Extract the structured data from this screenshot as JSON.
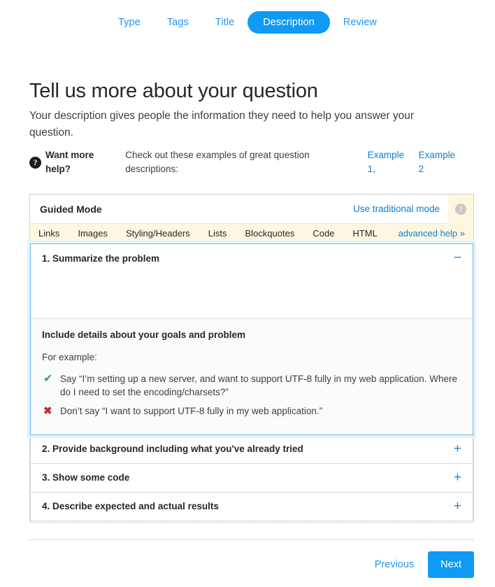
{
  "wizard": {
    "tabs": [
      {
        "label": "Type",
        "active": false
      },
      {
        "label": "Tags",
        "active": false
      },
      {
        "label": "Title",
        "active": false
      },
      {
        "label": "Description",
        "active": true
      },
      {
        "label": "Review",
        "active": false
      }
    ]
  },
  "heading": {
    "title": "Tell us more about your question",
    "subtitle": "Your description gives people the information they need to help you answer your question."
  },
  "help_line": {
    "icon": "question-mark-circle-icon",
    "strong": "Want more help?",
    "text": "Check out these examples of great question descriptions:",
    "link1": "Example 1,",
    "link2": "Example 2"
  },
  "editor": {
    "guided_mode_label": "Guided Mode",
    "traditional_mode_link": "Use traditional mode",
    "help_tab_icon": "question-mark-circle-icon",
    "help_glyph": "?",
    "format_items": [
      "Links",
      "Images",
      "Styling/Headers",
      "Lists",
      "Blockquotes",
      "Code",
      "HTML"
    ],
    "advanced_help": "advanced help »"
  },
  "sections": [
    {
      "title": "1. Summarize the problem",
      "toggle": "−",
      "expanded": true,
      "editor_value": "",
      "editor_placeholder": "",
      "detail": {
        "title": "Include details about your goals and problem",
        "for_example": "For example:",
        "examples": [
          {
            "icon": "check-icon",
            "glyph": "✔",
            "kind": "good",
            "text": "Say “I’m setting up a new server, and want to support UTF-8 fully in my web application. Where do I need to set the encoding/charsets?”"
          },
          {
            "icon": "cross-icon",
            "glyph": "✖",
            "kind": "bad",
            "text": "Don’t say “I want to support UTF-8 fully in my web application.”"
          }
        ]
      }
    },
    {
      "title": "2. Provide background including what you've already tried",
      "toggle": "+",
      "expanded": false
    },
    {
      "title": "3. Show some code",
      "toggle": "+",
      "expanded": false
    },
    {
      "title": "4. Describe expected and actual results",
      "toggle": "+",
      "expanded": false
    }
  ],
  "footer": {
    "previous_label": "Previous",
    "next_label": "Next"
  },
  "colors": {
    "accent_blue": "#0f9af5",
    "link_blue": "#0c80d4",
    "tab_blue": "#2196f3",
    "toolbar_cream": "#fdf7e2",
    "good_green": "#3f9c5b",
    "bad_red": "#c22e32",
    "active_border": "#6cb9ee"
  }
}
